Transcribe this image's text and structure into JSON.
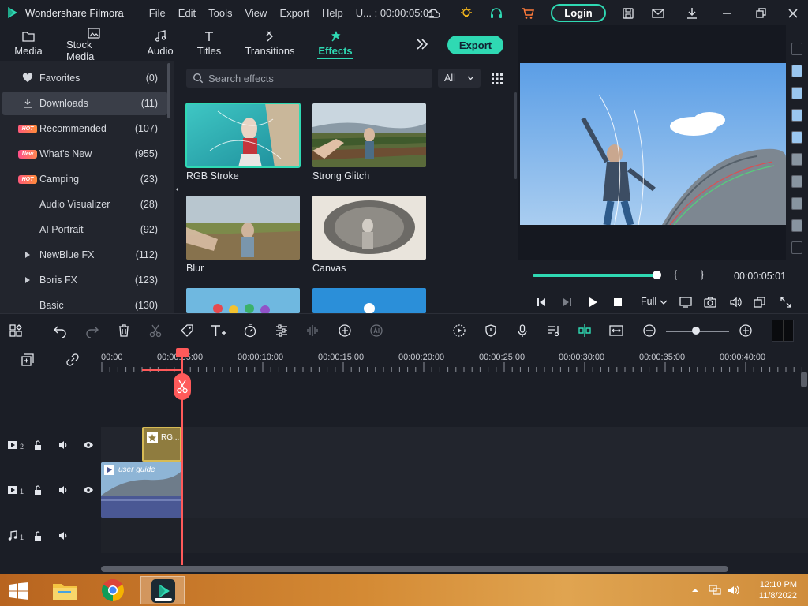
{
  "app": {
    "title": "Wondershare Filmora",
    "project": "U... : 00:00:05:01",
    "login_label": "Login"
  },
  "menu": [
    "File",
    "Edit",
    "Tools",
    "View",
    "Export",
    "Help"
  ],
  "media_tabs": [
    {
      "label": "Media",
      "icon": "folder-icon"
    },
    {
      "label": "Stock Media",
      "icon": "image-icon"
    },
    {
      "label": "Audio",
      "icon": "music-note-icon"
    },
    {
      "label": "Titles",
      "icon": "text-icon"
    },
    {
      "label": "Transitions",
      "icon": "transition-icon"
    },
    {
      "label": "Effects",
      "icon": "effects-icon",
      "active": true
    }
  ],
  "export_label": "Export",
  "categories": [
    {
      "label": "Favorites",
      "count": "(0)",
      "icon": "heart-icon"
    },
    {
      "label": "Downloads",
      "count": "(11)",
      "icon": "download-icon",
      "selected": true
    },
    {
      "label": "Recommended",
      "count": "(107)",
      "badge": "HOT"
    },
    {
      "label": "What's New",
      "count": "(955)",
      "badge": "New"
    },
    {
      "label": "Camping",
      "count": "(23)",
      "badge": "HOT"
    },
    {
      "label": "Audio Visualizer",
      "count": "(28)"
    },
    {
      "label": "AI Portrait",
      "count": "(92)"
    },
    {
      "label": "NewBlue FX",
      "count": "(112)",
      "expandable": true
    },
    {
      "label": "Boris FX",
      "count": "(123)",
      "expandable": true
    },
    {
      "label": "Basic",
      "count": "(130)"
    }
  ],
  "search": {
    "placeholder": "Search effects",
    "filter": "All"
  },
  "effects": [
    {
      "label": "RGB Stroke",
      "selected": true
    },
    {
      "label": "Strong Glitch"
    },
    {
      "label": "Blur"
    },
    {
      "label": "Canvas"
    }
  ],
  "preview": {
    "start_bracket": "{",
    "end_bracket": "}",
    "timecode": "00:00:05:01",
    "quality": "Full",
    "progress": 0.98
  },
  "ruler": [
    "00:00",
    "00:00:05:00",
    "00:00:10:00",
    "00:00:15:00",
    "00:00:20:00",
    "00:00:25:00",
    "00:00:30:00",
    "00:00:35:00",
    "00:00:40:00"
  ],
  "tracks": {
    "effect_clip": "RG...",
    "video_clip": "user guide",
    "video2_num": "2",
    "video1_num": "1",
    "audio1_num": "1"
  },
  "taskbar": {
    "time": "12:10 PM",
    "date": "11/8/2022"
  },
  "colors": {
    "accent": "#2fd9b3",
    "playhead": "#ff5a5a"
  }
}
